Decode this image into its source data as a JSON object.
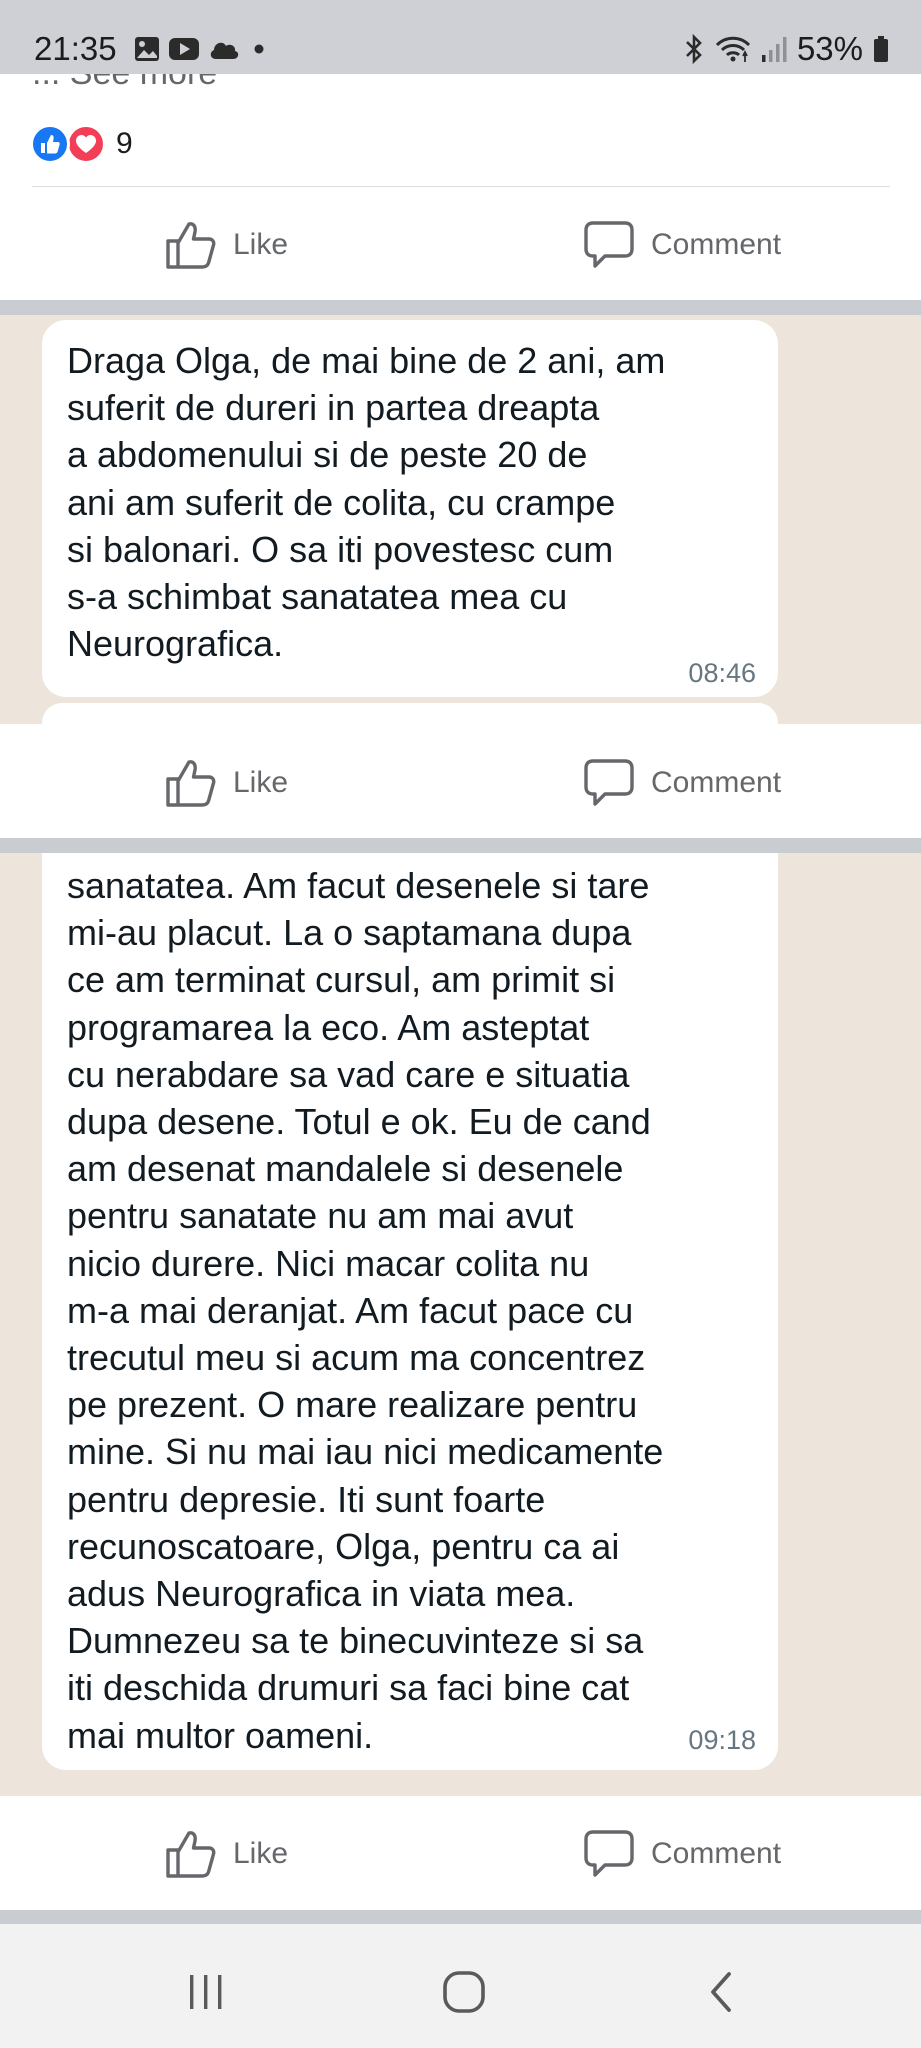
{
  "status_bar": {
    "time": "21:35",
    "battery": "53%",
    "icons_left": [
      "gallery-icon",
      "youtube-icon",
      "cloud-icon",
      "dot-icon"
    ],
    "icons_right": [
      "bluetooth-icon",
      "wifi-icon",
      "signal-icon",
      "battery-icon"
    ]
  },
  "post": {
    "see_more": "... See more",
    "reaction_count": "9",
    "reactions": [
      "like-reaction-icon",
      "love-reaction-icon"
    ],
    "like_label": "Like",
    "comment_label": "Comment"
  },
  "messages": [
    {
      "text": "Draga Olga, de mai bine de 2 ani, am\nsuferit de dureri in partea dreapta\na abdomenului si de peste 20 de\nani am suferit de colita, cu crampe\nsi balonari. O sa iti povestesc cum\ns-a schimbat sanatatea mea cu\nNeurografica.",
      "time": "08:46"
    },
    {
      "text": "sanatatea. Am facut desenele si tare\nmi-au placut. La o saptamana dupa\nce am terminat cursul, am primit si\nprogramarea la eco. Am asteptat\ncu nerabdare sa vad care e situatia\ndupa desene. Totul e ok. Eu de cand\nam desenat mandalele si desenele\npentru sanatate nu am mai avut\nnicio durere. Nici macar colita nu\nm-a mai deranjat. Am facut pace cu\ntrecutul meu si acum ma concentrez\npe prezent. O mare realizare pentru\nmine. Si nu mai iau nici medicamente\npentru depresie. Iti sunt foarte\nrecunoscatoare, Olga, pentru ca ai\nadus Neurografica in viata mea.\nDumnezeu sa te binecuvinteze si sa\niti deschida drumuri sa faci bine cat\nmai multor oameni.",
      "time": "09:18"
    }
  ],
  "nav": [
    "recents-button",
    "home-button",
    "back-button"
  ],
  "colors": {
    "status_bar": "#ced0d5",
    "separator": "#c9ccd1",
    "chat_background": "#ede4dc",
    "bubble": "#ffffff",
    "action_text": "#65676b",
    "like_blue": "#1877f2",
    "love_red": "#f33e58"
  }
}
